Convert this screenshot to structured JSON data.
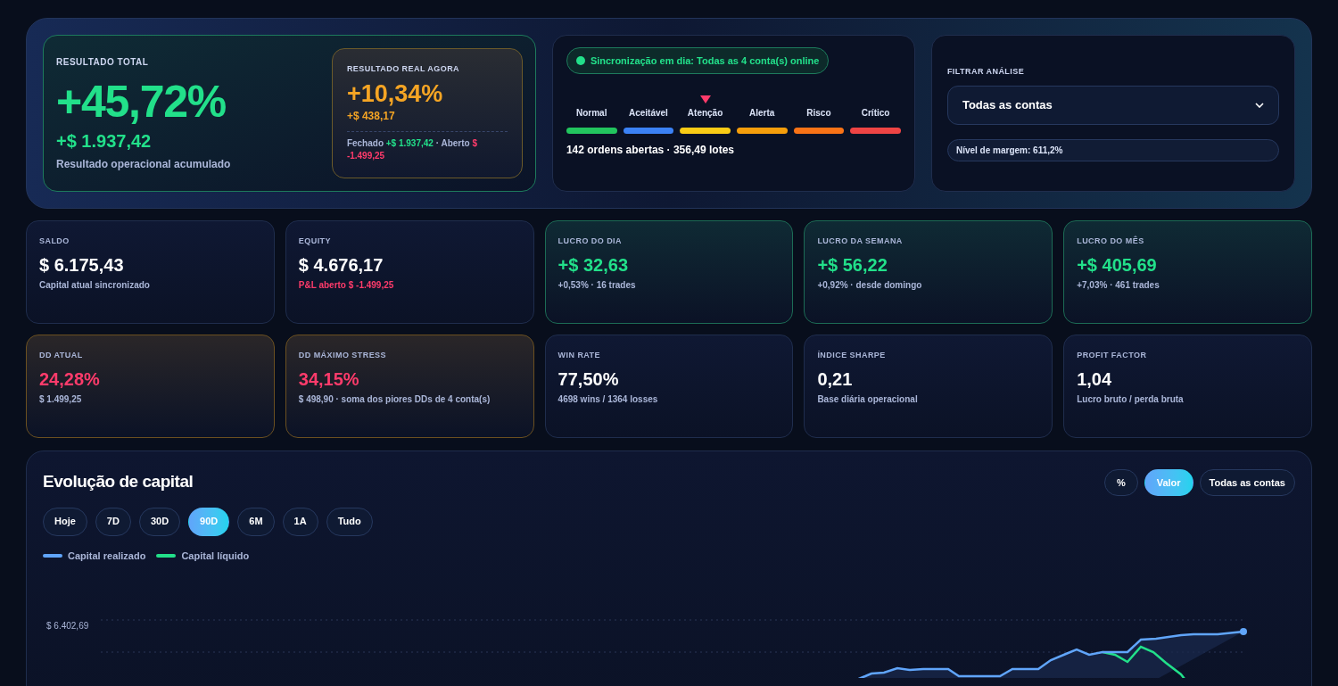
{
  "summary": {
    "total": {
      "label": "RESULTADO TOTAL",
      "value": "+45,72%",
      "amount": "+$ 1.937,42",
      "caption": "Resultado operacional acumulado"
    },
    "real_now": {
      "label": "RESULTADO REAL AGORA",
      "value": "+10,34%",
      "amount": "+$ 438,17",
      "breakdown": [
        {
          "text": "Fechado",
          "color": "#aab6d8"
        },
        {
          "text": "+$ 1.937,42",
          "color": "#22e08a"
        },
        {
          "text": "· Aberto",
          "color": "#aab6d8"
        },
        {
          "text": "$ -1.499,25",
          "color": "#ff3b6b"
        }
      ]
    }
  },
  "status": {
    "sync": "Sincronização em dia: Todas as 4 conta(s) online",
    "risk_levels": [
      {
        "label": "Normal",
        "color": "#22c55e",
        "selected": false
      },
      {
        "label": "Aceitável",
        "color": "#3b82f6",
        "selected": false
      },
      {
        "label": "Atenção",
        "color": "#facc15",
        "selected": true
      },
      {
        "label": "Alerta",
        "color": "#f59e0b",
        "selected": false
      },
      {
        "label": "Risco",
        "color": "#f97316",
        "selected": false
      },
      {
        "label": "Crítico",
        "color": "#ef4444",
        "selected": false
      }
    ],
    "orders": "142 ordens abertas · 356,49 lotes"
  },
  "filter": {
    "label": "FILTRAR ANÁLISE",
    "value": "Todas as contas",
    "margin": "Nível de margem: 611,2%"
  },
  "metrics": [
    {
      "kind": "plain",
      "label": "SALDO",
      "value": "$ 6.175,43",
      "note": "Capital atual sincronizado",
      "note_negative": false
    },
    {
      "kind": "plain",
      "label": "EQUITY",
      "value": "$ 4.676,17",
      "note": "P&L aberto $ -1.499,25",
      "note_negative": true
    },
    {
      "kind": "gain",
      "label": "LUCRO DO DIA",
      "value": "+$ 32,63",
      "note": "+0,53% · 16 trades",
      "note_negative": false
    },
    {
      "kind": "gain",
      "label": "LUCRO DA SEMANA",
      "value": "+$ 56,22",
      "note": "+0,92% · desde domingo",
      "note_negative": false
    },
    {
      "kind": "gain",
      "label": "LUCRO DO MÊS",
      "value": "+$ 405,69",
      "note": "+7,03% · 461 trades",
      "note_negative": false
    },
    {
      "kind": "drawdown",
      "label": "DD ATUAL",
      "value": "24,28%",
      "note": "$ 1.499,25",
      "note_negative": false
    },
    {
      "kind": "drawdown",
      "label": "DD MÁXIMO STRESS",
      "value": "34,15%",
      "note": "$ 498,90 · soma dos piores DDs de 4 conta(s)",
      "note_negative": false
    },
    {
      "kind": "plain",
      "label": "WIN RATE",
      "value": "77,50%",
      "note": "4698 wins / 1364 losses",
      "note_negative": false
    },
    {
      "kind": "plain",
      "label": "ÍNDICE SHARPE",
      "value": "0,21",
      "note": "Base diária operacional",
      "note_negative": false
    },
    {
      "kind": "plain",
      "label": "PROFIT FACTOR",
      "value": "1,04",
      "note": "Lucro bruto / perda bruta",
      "note_negative": false
    }
  ],
  "capital_chart": {
    "title": "Evolução de capital",
    "modes": [
      {
        "label": "%",
        "selected": false
      },
      {
        "label": "Valor",
        "selected": true
      }
    ],
    "account_button": "Todas as contas",
    "ranges": [
      {
        "label": "Hoje",
        "selected": false
      },
      {
        "label": "7D",
        "selected": false
      },
      {
        "label": "30D",
        "selected": false
      },
      {
        "label": "90D",
        "selected": true
      },
      {
        "label": "6M",
        "selected": false
      },
      {
        "label": "1A",
        "selected": false
      },
      {
        "label": "Tudo",
        "selected": false
      }
    ],
    "legend": [
      {
        "name": "Capital realizado",
        "color": "#60a5fa"
      },
      {
        "name": "Capital líquido",
        "color": "#22e08a"
      }
    ],
    "y_tick_label": "$ 6.402,69"
  }
}
